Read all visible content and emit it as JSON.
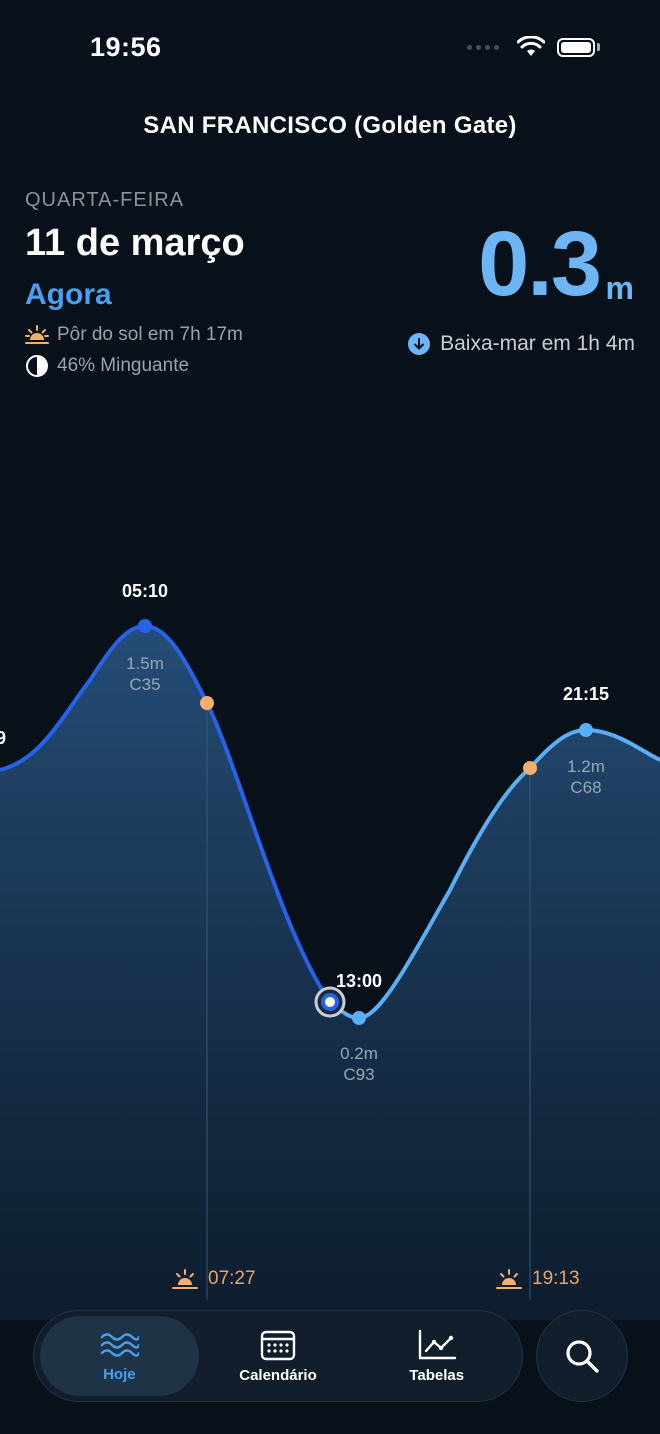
{
  "status": {
    "time": "19:56"
  },
  "location": {
    "title": "SAN FRANCISCO (Golden Gate)"
  },
  "today": {
    "weekday": "QUARTA-FEIRA",
    "date": "11 de março",
    "now_label": "Agora",
    "sunset_text": "Pôr do sol em 7h 17m",
    "moon_text": "46% Minguante",
    "height_value": "0.3",
    "height_unit": "m",
    "next_tide": "Baixa-mar em 1h 4m"
  },
  "chart_data": {
    "type": "line",
    "extremes": [
      {
        "time": "05:10",
        "height": "1.5m",
        "coef": "C35",
        "kind": "high"
      },
      {
        "time": "13:00",
        "height": "0.2m",
        "coef": "C93",
        "kind": "low"
      },
      {
        "time": "21:15",
        "height": "1.2m",
        "coef": "C68",
        "kind": "high"
      }
    ],
    "left_edge_label": "9",
    "sunrise": "07:27",
    "sunset": "19:13",
    "current_time": "12:18",
    "colors": {
      "past": "#2563eb",
      "future": "#5aaef5",
      "sun": "#f6ae6b"
    }
  },
  "tabs": [
    {
      "label": "Hoje",
      "icon": "waves-icon"
    },
    {
      "label": "Calendário",
      "icon": "calendar-icon"
    },
    {
      "label": "Tabelas",
      "icon": "chart-icon"
    }
  ],
  "search": {
    "icon": "search-icon"
  }
}
